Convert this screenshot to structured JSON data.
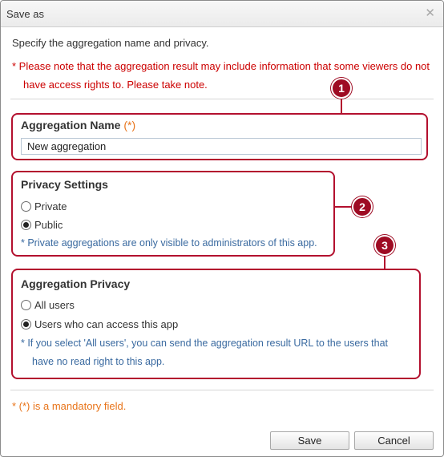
{
  "dialog": {
    "title": "Save as",
    "close_glyph": "✕",
    "intro": "Specify the aggregation name and privacy.",
    "warning_line1": "* Please note that the aggregation result may include information that some viewers do not",
    "warning_line2": "have access rights to. Please take note."
  },
  "aggregation_name": {
    "label": "Aggregation Name",
    "required_mark": "(*)",
    "value": "New aggregation",
    "badge": "1"
  },
  "privacy_settings": {
    "label": "Privacy Settings",
    "options": [
      {
        "label": "Private",
        "checked": false
      },
      {
        "label": "Public",
        "checked": true
      }
    ],
    "note": "* Private aggregations are only visible to administrators of this app.",
    "badge": "2"
  },
  "aggregation_privacy": {
    "label": "Aggregation Privacy",
    "options": [
      {
        "label": "All users",
        "checked": false
      },
      {
        "label": "Users who can access this app",
        "checked": true
      }
    ],
    "note_line1": "* If you select 'All users', you can send the aggregation result URL to the users that",
    "note_line2": "have no read right to this app.",
    "badge": "3"
  },
  "footer": {
    "mandatory_note": "* (*) is a mandatory field.",
    "save_label": "Save",
    "cancel_label": "Cancel"
  },
  "colors": {
    "callout": "#b3102e",
    "warning": "#cc0000",
    "note": "#3a6aa0",
    "mandatory": "#e8741a"
  }
}
